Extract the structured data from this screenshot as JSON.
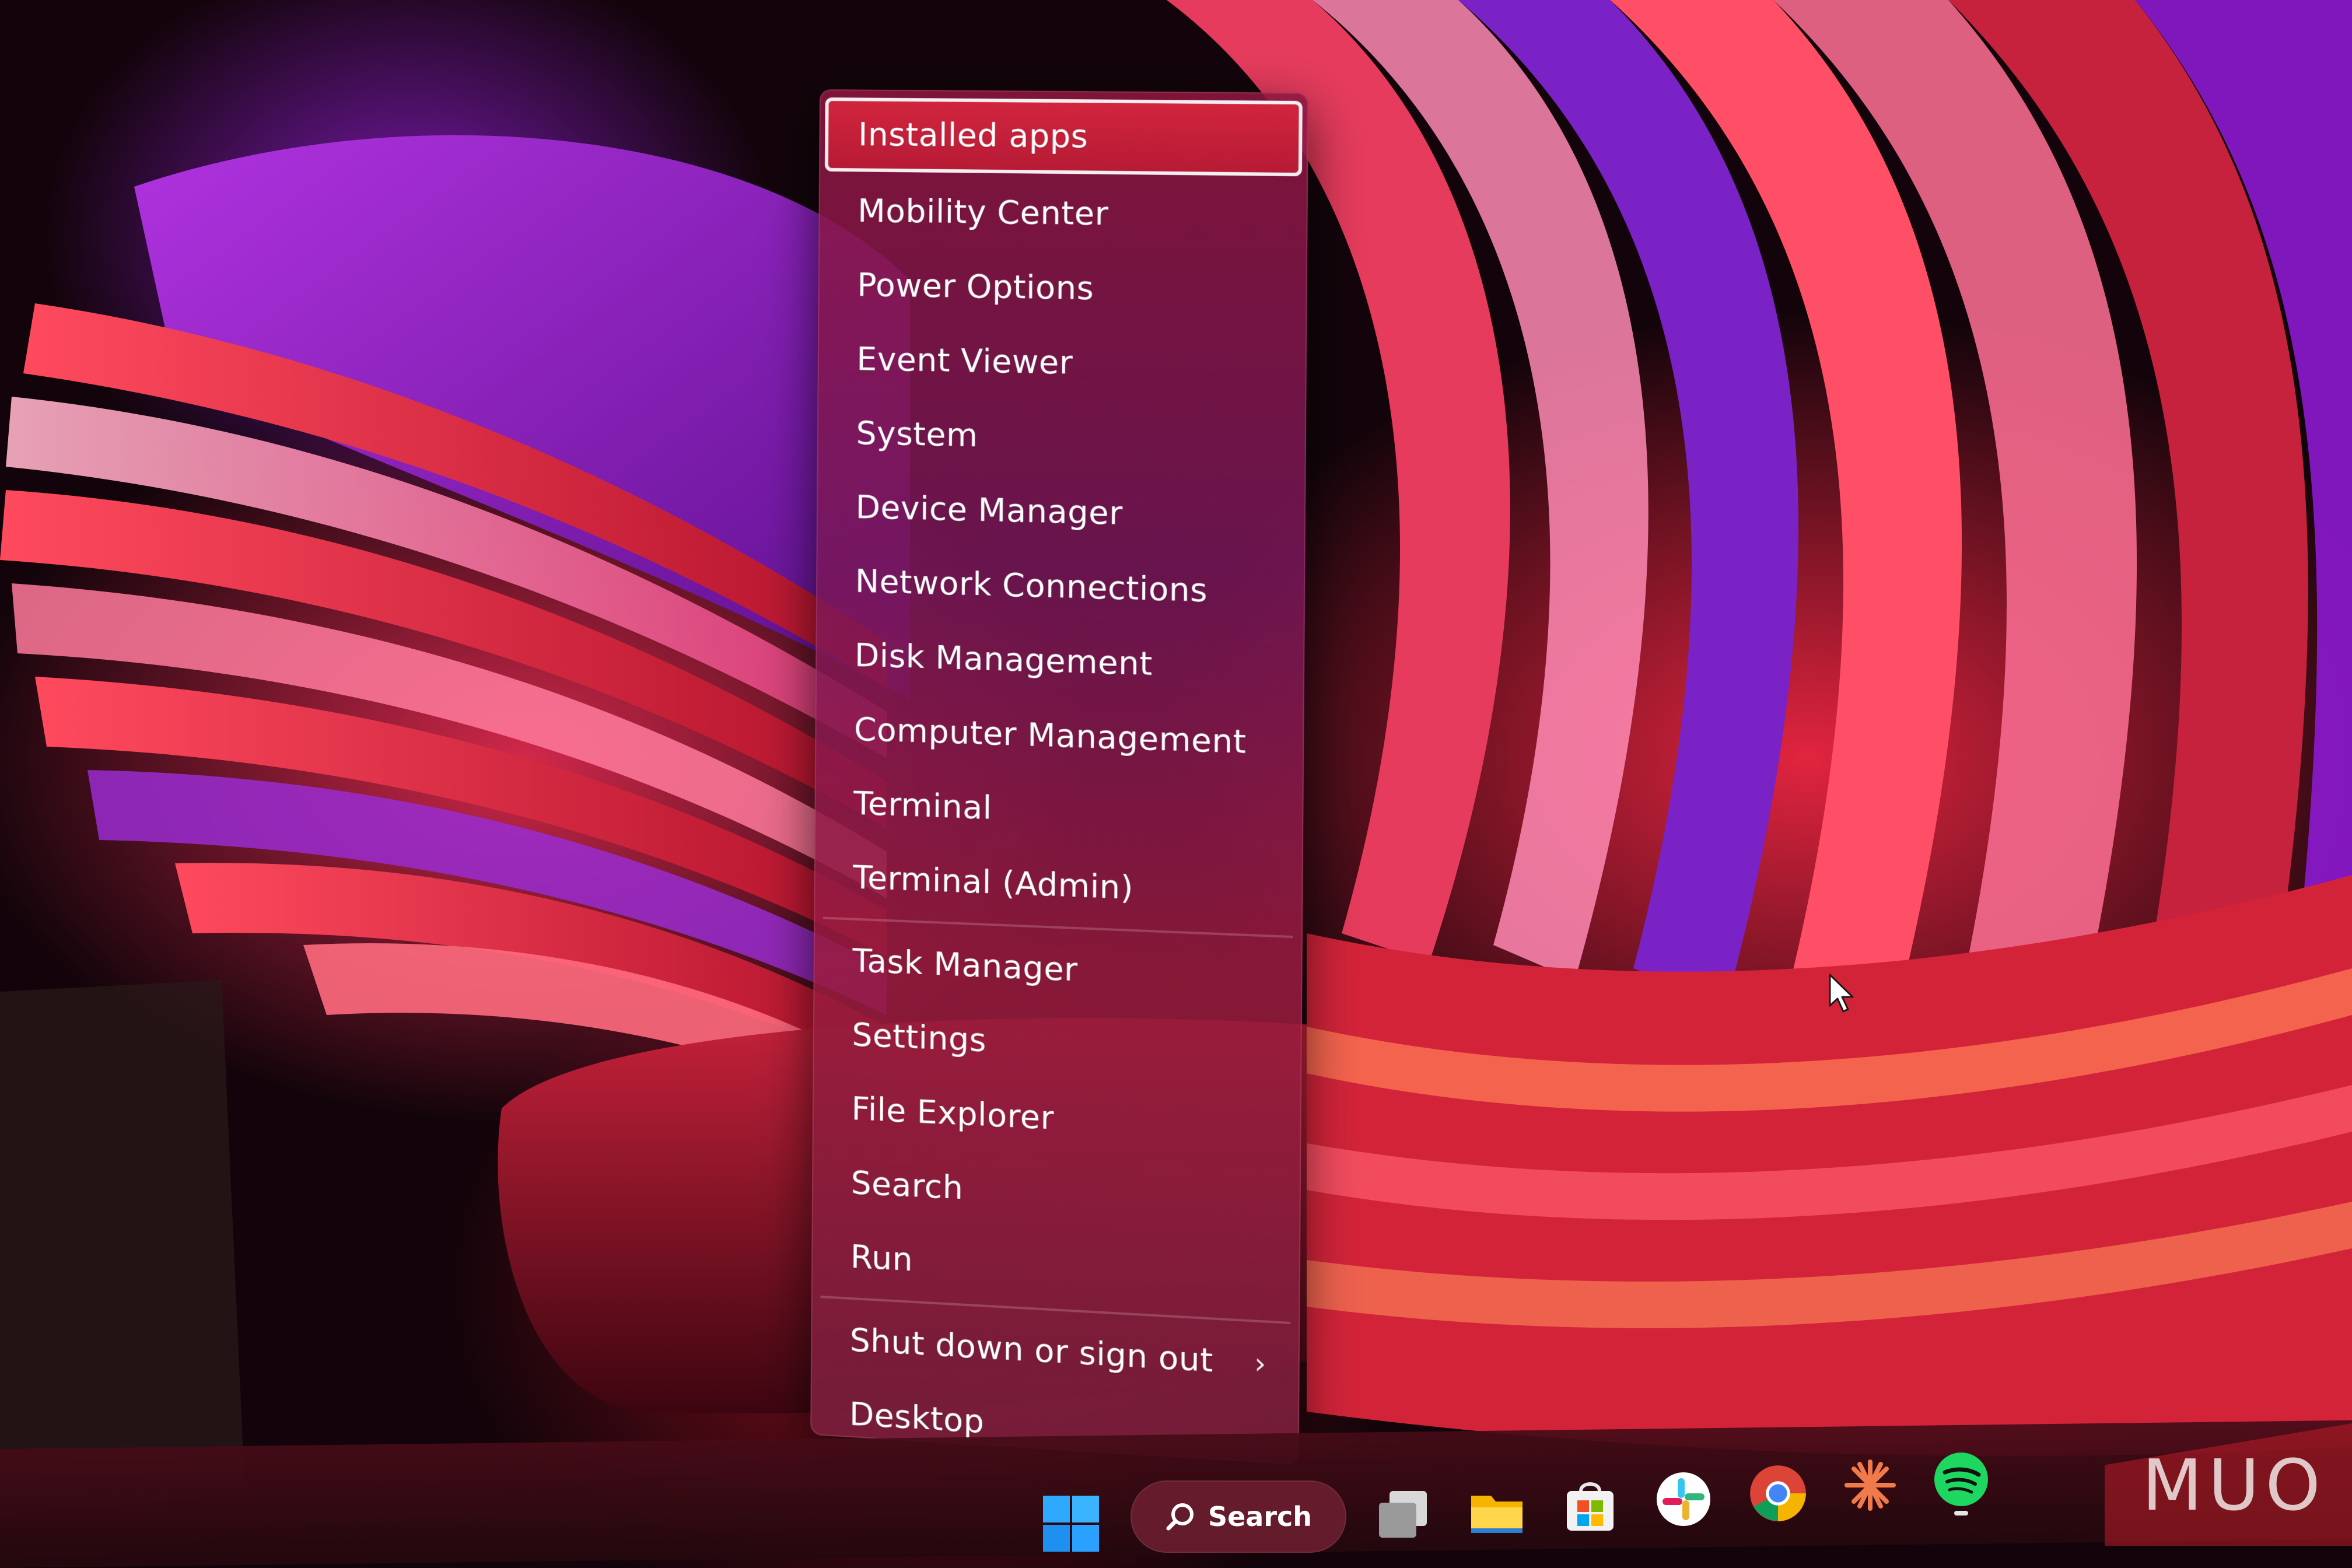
{
  "context_menu": {
    "items": [
      {
        "label": "Installed apps",
        "selected": true
      },
      {
        "label": "Mobility Center"
      },
      {
        "label": "Power Options"
      },
      {
        "label": "Event Viewer"
      },
      {
        "label": "System"
      },
      {
        "label": "Device Manager"
      },
      {
        "label": "Network Connections"
      },
      {
        "label": "Disk Management"
      },
      {
        "label": "Computer Management"
      },
      {
        "label": "Terminal"
      },
      {
        "label": "Terminal (Admin)"
      }
    ],
    "items_group2": [
      {
        "label": "Task Manager"
      },
      {
        "label": "Settings"
      },
      {
        "label": "File Explorer"
      },
      {
        "label": "Search"
      },
      {
        "label": "Run"
      }
    ],
    "items_group3": [
      {
        "label": "Shut down or sign out",
        "submenu_icon": "chevron-right-icon"
      },
      {
        "label": "Desktop"
      }
    ]
  },
  "taskbar": {
    "search_label": "Search",
    "icons": [
      "windows-start-icon",
      "search-icon",
      "task-view-icon",
      "file-explorer-icon",
      "microsoft-store-icon",
      "slack-icon",
      "chrome-icon",
      "claude-icon",
      "spotify-icon"
    ]
  },
  "watermark": {
    "text": "MUO"
  },
  "colors": {
    "menu_selected": "#c41f39",
    "menu_selected_border": "#f3eef0",
    "taskbar": "#3a0a14",
    "wallpaper_purple": "#8b1fc2",
    "wallpaper_red": "#e2243f"
  }
}
